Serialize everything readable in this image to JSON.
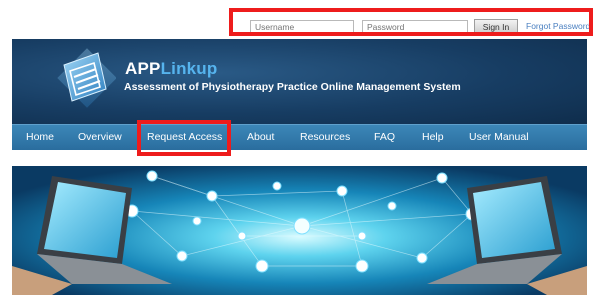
{
  "login": {
    "username_placeholder": "Username",
    "password_placeholder": "Password",
    "signin_label": "Sign In",
    "forgot_label": "Forgot Password"
  },
  "header": {
    "brand_part1": "APP",
    "brand_part2": "Linkup",
    "tagline": "Assessment of Physiotherapy Practice Online Management System",
    "logo_icon": "stacked-pages-logo-icon"
  },
  "nav": {
    "items": [
      {
        "label": "Home"
      },
      {
        "label": "Overview"
      },
      {
        "label": "Request Access"
      },
      {
        "label": "About"
      },
      {
        "label": "Resources"
      },
      {
        "label": "FAQ"
      },
      {
        "label": "Help"
      },
      {
        "label": "User Manual"
      }
    ]
  },
  "banner": {
    "image": "network-laptops-banner"
  },
  "colors": {
    "highlight": "#ee1c1c",
    "header_bg": "#173d63",
    "nav_bg": "#2f77a8",
    "brand_accent": "#56b4ee",
    "link": "#4a7fc0"
  }
}
